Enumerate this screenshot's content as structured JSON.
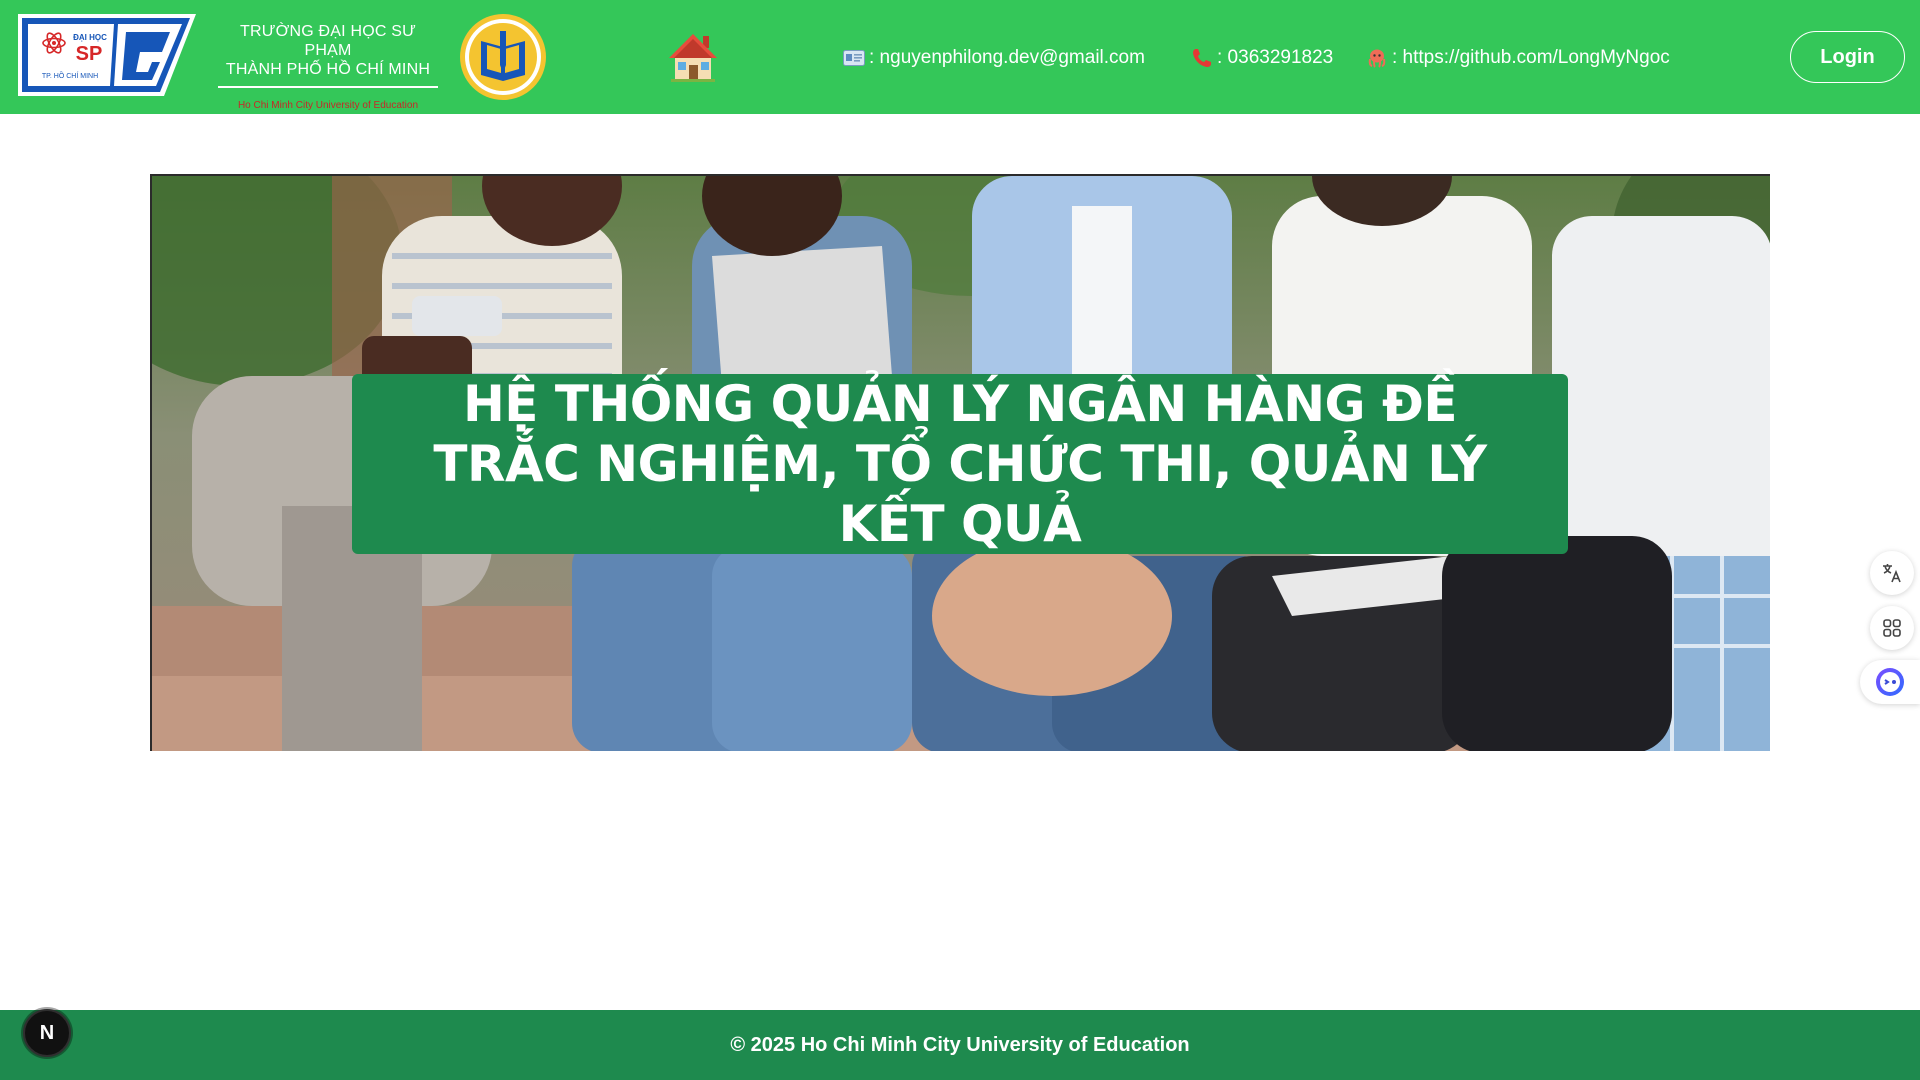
{
  "header": {
    "university_line1": "TRƯỜNG ĐẠI HỌC SƯ PHẠM",
    "university_line2": "THÀNH PHỐ HỒ CHÍ MINH",
    "university_en": "Ho Chi Minh City University of Education",
    "logo_sp": {
      "top_text": "ĐẠI HỌC",
      "main_text": "SP",
      "bottom_text": "TP. HỒ CHÍ MINH"
    },
    "home_icon": "house-icon",
    "contacts": {
      "email": ": nguyenphilong.dev@gmail.com",
      "phone": ": 0363291823",
      "github": ": https://github.com/LongMyNgoc"
    },
    "login_label": "Login"
  },
  "hero": {
    "title": "HỆ THỐNG QUẢN LÝ NGÂN HÀNG ĐỀ TRẮC NGHIỆM, TỔ CHỨC THI, QUẢN LÝ KẾT QUẢ"
  },
  "side_tools": [
    "translate-icon",
    "apps-icon",
    "assistant-icon"
  ],
  "footer": {
    "copyright": "© 2025 Ho Chi Minh City University of Education"
  },
  "next_badge": "N",
  "colors": {
    "header_bg": "#34c759",
    "banner_bg": "#1e8a4e",
    "footer_bg": "#1e8a4e"
  }
}
